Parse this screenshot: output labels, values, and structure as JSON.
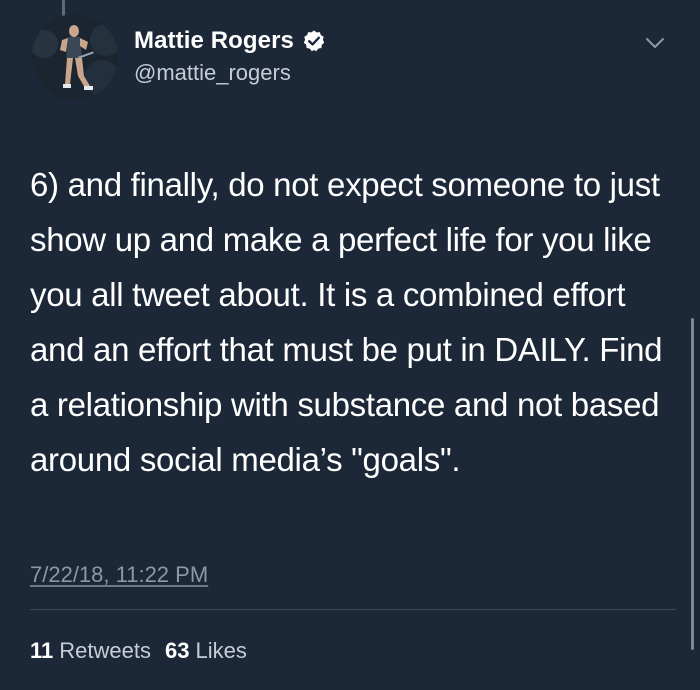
{
  "author": {
    "display_name": "Mattie Rogers",
    "handle": "@mattie_rogers",
    "verified": true,
    "avatar_icon": "profile-photo-icon"
  },
  "tweet": {
    "text": "6) and finally, do not expect someone to just show up and make a perfect life for you like you all tweet about. It is a combined effort and an effort that must be put in DAILY. Find a relationship with substance and not based around social media’s \"goals\".",
    "timestamp": "7/22/18, 11:22 PM"
  },
  "stats": {
    "retweets_count": "11",
    "retweets_label": "Retweets",
    "likes_count": "63",
    "likes_label": "Likes"
  },
  "colors": {
    "background": "#1c2838",
    "text_primary": "#ffffff",
    "text_secondary": "#8b98a6",
    "verified_badge": "#ffffff"
  }
}
